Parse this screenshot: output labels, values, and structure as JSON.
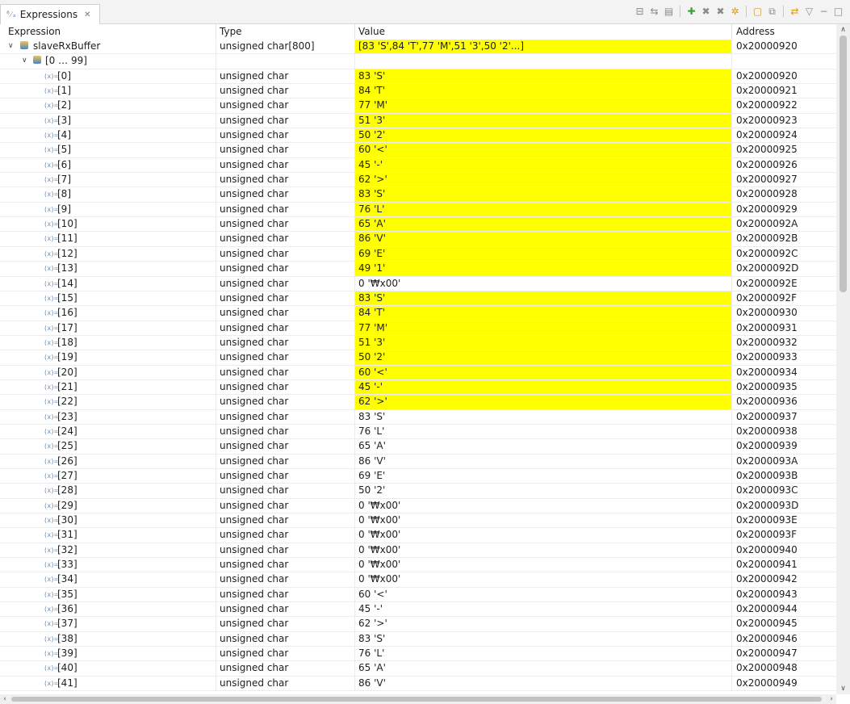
{
  "tab": {
    "title": "Expressions",
    "icon": "expressions-icon",
    "close": "✕"
  },
  "toolbar": {
    "icons": [
      "collapse-all-icon",
      "show-type-names-icon",
      "toggle-layout-icon",
      "add-expression-icon",
      "remove-expression-icon",
      "remove-all-expressions-icon",
      "refresh-icon",
      "new-view-icon",
      "pin-icon",
      "link-with-debug-context-icon",
      "view-menu-icon",
      "minimize-icon",
      "maximize-icon"
    ]
  },
  "columns": {
    "expression": "Expression",
    "type": "Type",
    "value": "Value",
    "address": "Address"
  },
  "highlight_color": "#ffff00",
  "root": {
    "name": "slaveRxBuffer",
    "type": "unsigned char[800]",
    "value": "[83 'S',84 'T',77 'M',51 '3',50 '2'...]",
    "address": "0x20000920",
    "highlighted": true
  },
  "group": {
    "name": "[0 … 99]"
  },
  "rows": [
    {
      "name": "[0]",
      "type": "unsigned char",
      "value": "83 'S'",
      "address": "0x20000920",
      "highlighted": true
    },
    {
      "name": "[1]",
      "type": "unsigned char",
      "value": "84 'T'",
      "address": "0x20000921",
      "highlighted": true
    },
    {
      "name": "[2]",
      "type": "unsigned char",
      "value": "77 'M'",
      "address": "0x20000922",
      "highlighted": true
    },
    {
      "name": "[3]",
      "type": "unsigned char",
      "value": "51 '3'",
      "address": "0x20000923",
      "highlighted": true
    },
    {
      "name": "[4]",
      "type": "unsigned char",
      "value": "50 '2'",
      "address": "0x20000924",
      "highlighted": true
    },
    {
      "name": "[5]",
      "type": "unsigned char",
      "value": "60 '<'",
      "address": "0x20000925",
      "highlighted": true
    },
    {
      "name": "[6]",
      "type": "unsigned char",
      "value": "45 '-'",
      "address": "0x20000926",
      "highlighted": true
    },
    {
      "name": "[7]",
      "type": "unsigned char",
      "value": "62 '>'",
      "address": "0x20000927",
      "highlighted": true
    },
    {
      "name": "[8]",
      "type": "unsigned char",
      "value": "83 'S'",
      "address": "0x20000928",
      "highlighted": true
    },
    {
      "name": "[9]",
      "type": "unsigned char",
      "value": "76 'L'",
      "address": "0x20000929",
      "highlighted": true
    },
    {
      "name": "[10]",
      "type": "unsigned char",
      "value": "65 'A'",
      "address": "0x2000092A",
      "highlighted": true
    },
    {
      "name": "[11]",
      "type": "unsigned char",
      "value": "86 'V'",
      "address": "0x2000092B",
      "highlighted": true
    },
    {
      "name": "[12]",
      "type": "unsigned char",
      "value": "69 'E'",
      "address": "0x2000092C",
      "highlighted": true
    },
    {
      "name": "[13]",
      "type": "unsigned char",
      "value": "49 '1'",
      "address": "0x2000092D",
      "highlighted": true
    },
    {
      "name": "[14]",
      "type": "unsigned char",
      "value": "0 '₩x00'",
      "address": "0x2000092E",
      "highlighted": false
    },
    {
      "name": "[15]",
      "type": "unsigned char",
      "value": "83 'S'",
      "address": "0x2000092F",
      "highlighted": true
    },
    {
      "name": "[16]",
      "type": "unsigned char",
      "value": "84 'T'",
      "address": "0x20000930",
      "highlighted": true
    },
    {
      "name": "[17]",
      "type": "unsigned char",
      "value": "77 'M'",
      "address": "0x20000931",
      "highlighted": true
    },
    {
      "name": "[18]",
      "type": "unsigned char",
      "value": "51 '3'",
      "address": "0x20000932",
      "highlighted": true
    },
    {
      "name": "[19]",
      "type": "unsigned char",
      "value": "50 '2'",
      "address": "0x20000933",
      "highlighted": true
    },
    {
      "name": "[20]",
      "type": "unsigned char",
      "value": "60 '<'",
      "address": "0x20000934",
      "highlighted": true
    },
    {
      "name": "[21]",
      "type": "unsigned char",
      "value": "45 '-'",
      "address": "0x20000935",
      "highlighted": true
    },
    {
      "name": "[22]",
      "type": "unsigned char",
      "value": "62 '>'",
      "address": "0x20000936",
      "highlighted": true
    },
    {
      "name": "[23]",
      "type": "unsigned char",
      "value": "83 'S'",
      "address": "0x20000937",
      "highlighted": false
    },
    {
      "name": "[24]",
      "type": "unsigned char",
      "value": "76 'L'",
      "address": "0x20000938",
      "highlighted": false
    },
    {
      "name": "[25]",
      "type": "unsigned char",
      "value": "65 'A'",
      "address": "0x20000939",
      "highlighted": false
    },
    {
      "name": "[26]",
      "type": "unsigned char",
      "value": "86 'V'",
      "address": "0x2000093A",
      "highlighted": false
    },
    {
      "name": "[27]",
      "type": "unsigned char",
      "value": "69 'E'",
      "address": "0x2000093B",
      "highlighted": false
    },
    {
      "name": "[28]",
      "type": "unsigned char",
      "value": "50 '2'",
      "address": "0x2000093C",
      "highlighted": false
    },
    {
      "name": "[29]",
      "type": "unsigned char",
      "value": "0 '₩x00'",
      "address": "0x2000093D",
      "highlighted": false
    },
    {
      "name": "[30]",
      "type": "unsigned char",
      "value": "0 '₩x00'",
      "address": "0x2000093E",
      "highlighted": false
    },
    {
      "name": "[31]",
      "type": "unsigned char",
      "value": "0 '₩x00'",
      "address": "0x2000093F",
      "highlighted": false
    },
    {
      "name": "[32]",
      "type": "unsigned char",
      "value": "0 '₩x00'",
      "address": "0x20000940",
      "highlighted": false
    },
    {
      "name": "[33]",
      "type": "unsigned char",
      "value": "0 '₩x00'",
      "address": "0x20000941",
      "highlighted": false
    },
    {
      "name": "[34]",
      "type": "unsigned char",
      "value": "0 '₩x00'",
      "address": "0x20000942",
      "highlighted": false
    },
    {
      "name": "[35]",
      "type": "unsigned char",
      "value": "60 '<'",
      "address": "0x20000943",
      "highlighted": false
    },
    {
      "name": "[36]",
      "type": "unsigned char",
      "value": "45 '-'",
      "address": "0x20000944",
      "highlighted": false
    },
    {
      "name": "[37]",
      "type": "unsigned char",
      "value": "62 '>'",
      "address": "0x20000945",
      "highlighted": false
    },
    {
      "name": "[38]",
      "type": "unsigned char",
      "value": "83 'S'",
      "address": "0x20000946",
      "highlighted": false
    },
    {
      "name": "[39]",
      "type": "unsigned char",
      "value": "76 'L'",
      "address": "0x20000947",
      "highlighted": false
    },
    {
      "name": "[40]",
      "type": "unsigned char",
      "value": "65 'A'",
      "address": "0x20000948",
      "highlighted": false
    },
    {
      "name": "[41]",
      "type": "unsigned char",
      "value": "86 'V'",
      "address": "0x20000949",
      "highlighted": false
    }
  ]
}
